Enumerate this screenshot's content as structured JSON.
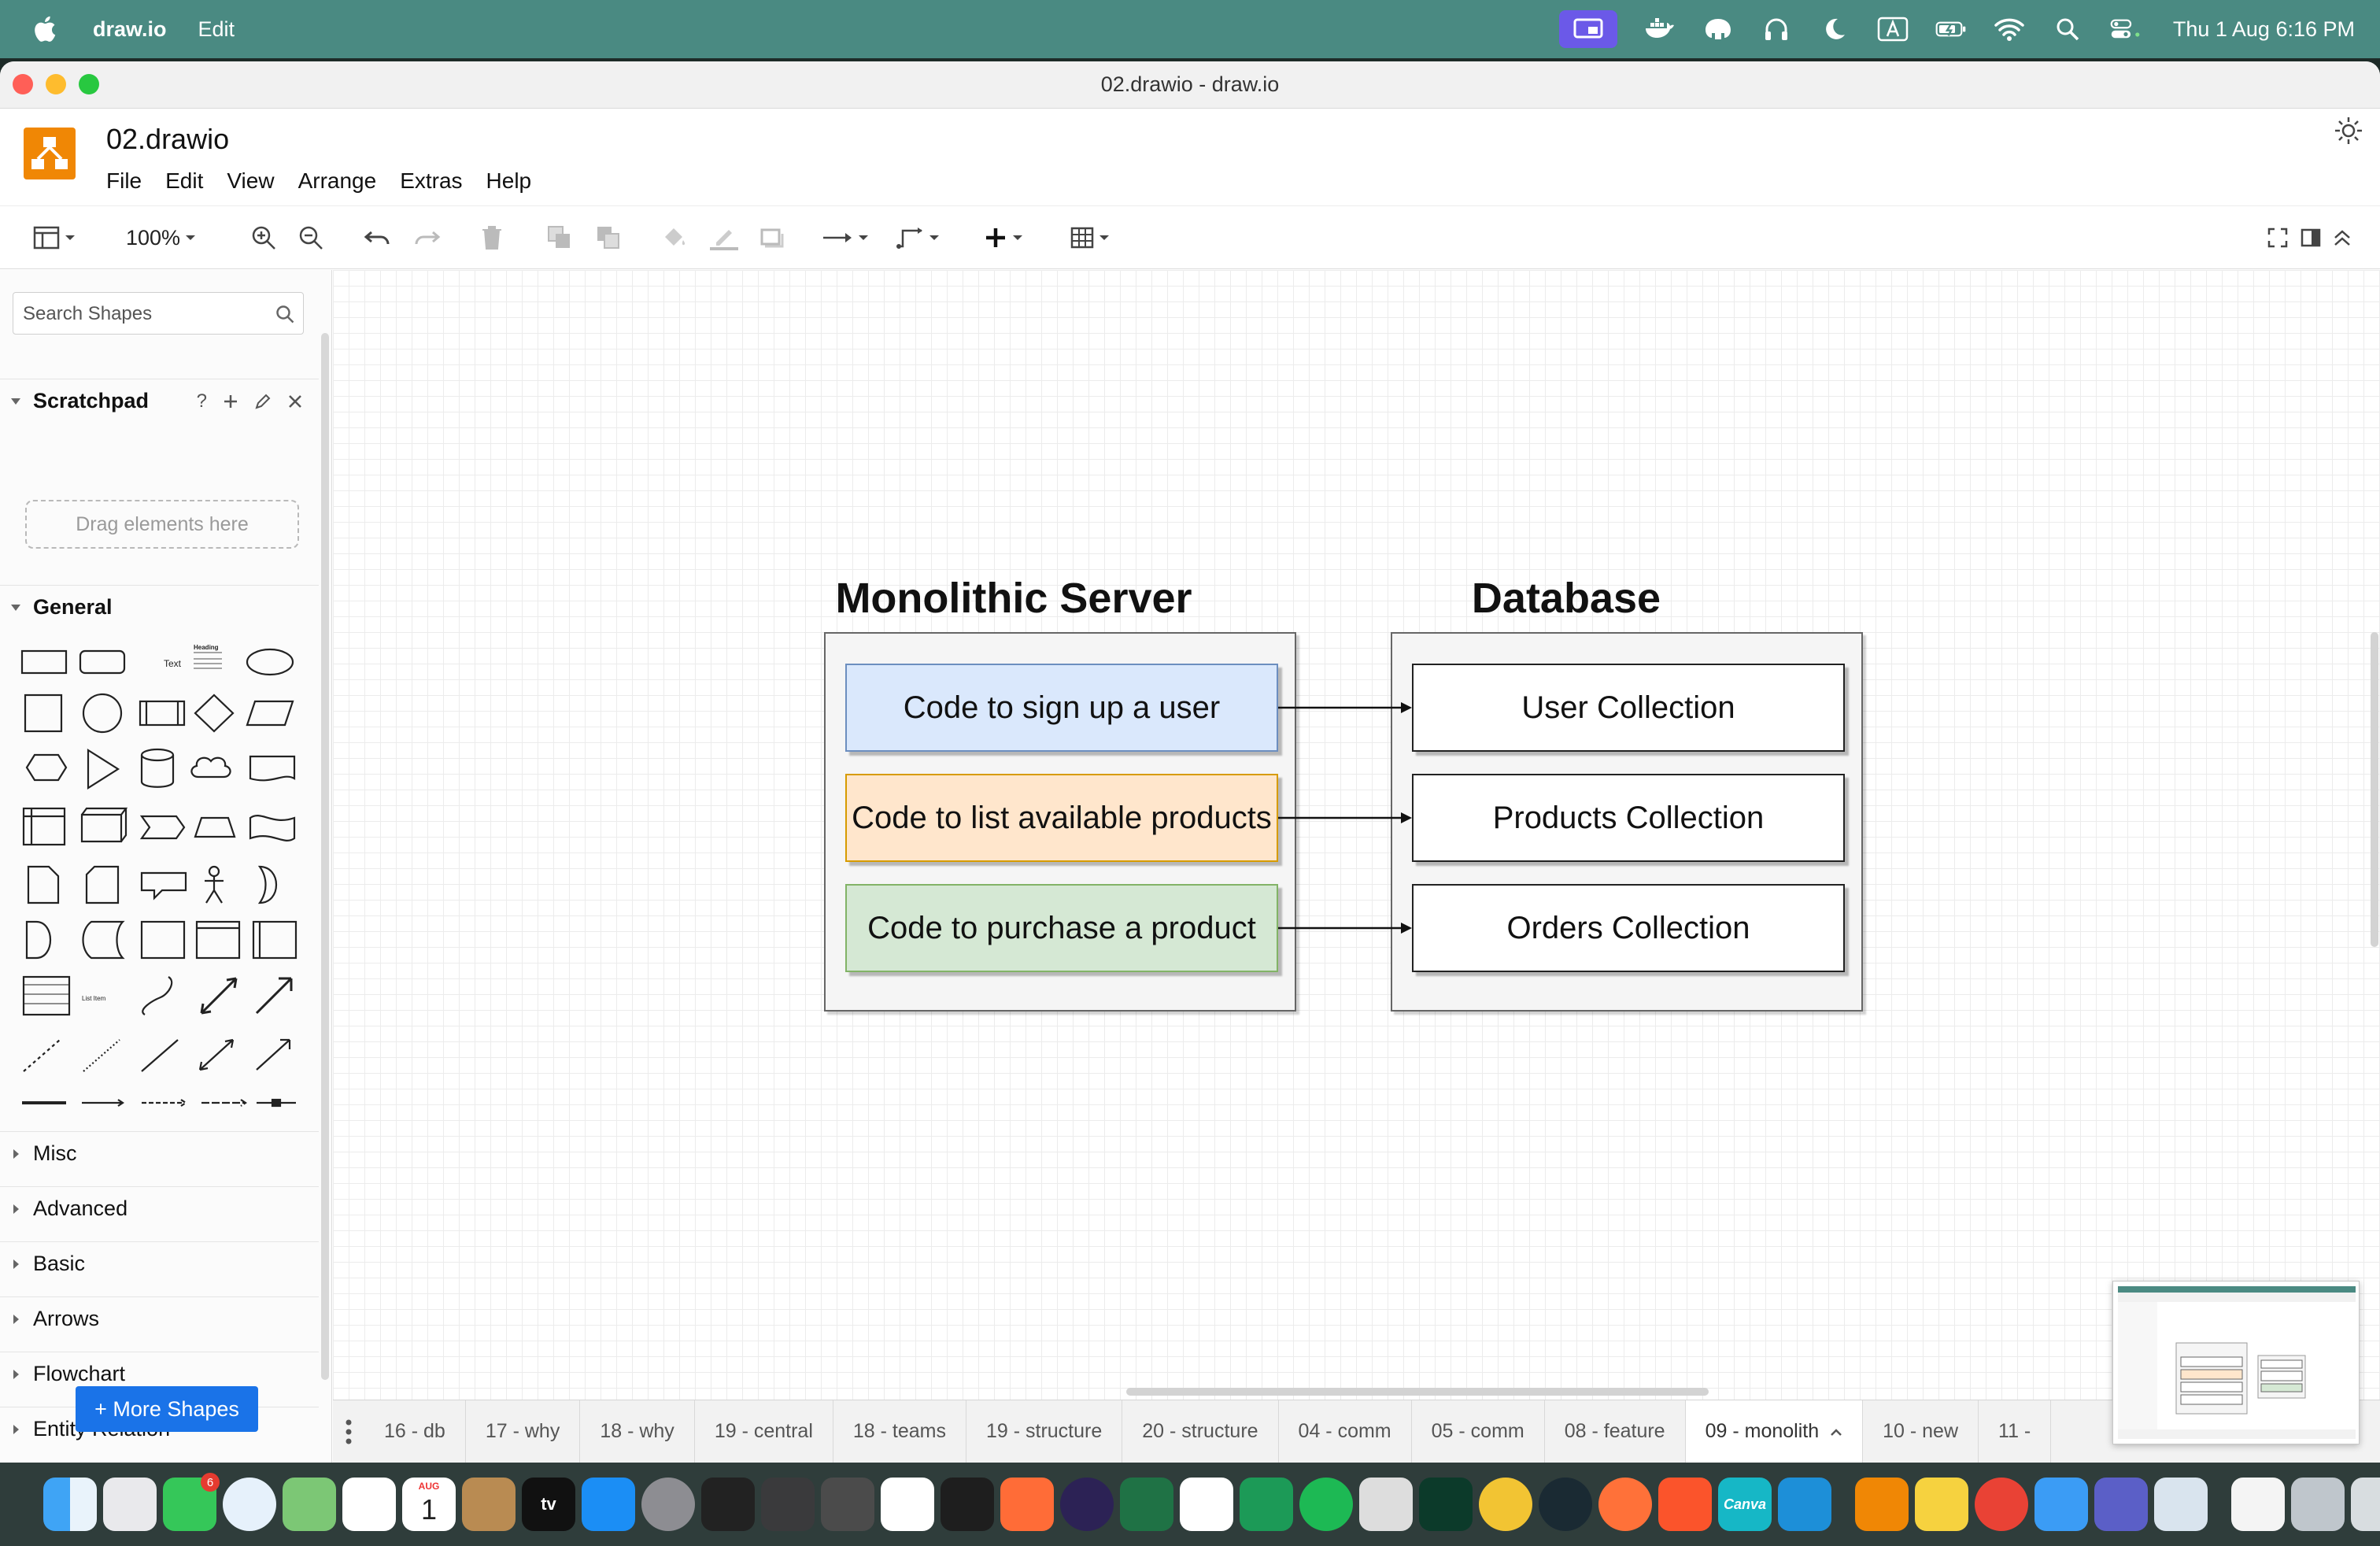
{
  "menubar": {
    "app_name": "draw.io",
    "menu_edit": "Edit",
    "clock": "Thu 1 Aug  6:16 PM",
    "status_icons": [
      "screen-mirroring-icon",
      "docker-icon",
      "tableplus-icon",
      "headphones-icon",
      "moon-icon",
      "input-source-icon",
      "battery-icon",
      "wifi-icon",
      "spotlight-icon",
      "control-center-icon"
    ]
  },
  "window": {
    "title": "02.drawio - draw.io"
  },
  "header": {
    "file_title": "02.drawio",
    "menus": [
      "File",
      "Edit",
      "View",
      "Arrange",
      "Extras",
      "Help"
    ]
  },
  "toolbar": {
    "zoom": "100%"
  },
  "sidebar": {
    "search_placeholder": "Search Shapes",
    "scratchpad": {
      "title": "Scratchpad",
      "help": "?",
      "drag_hint": "Drag elements here"
    },
    "general": {
      "title": "General",
      "text_shape_label": "Text",
      "heading_shape_label": "Heading",
      "list_item_label": "List Item"
    },
    "collapsed_sections": [
      "Misc",
      "Advanced",
      "Basic",
      "Arrows",
      "Flowchart",
      "Entity Relation"
    ],
    "more_shapes": "+ More Shapes"
  },
  "diagram": {
    "server_title": "Monolithic Server",
    "database_title": "Database",
    "server_blocks": [
      {
        "label": "Code to sign up a user",
        "fill": "#dae8fc",
        "stroke": "#6c8ebf"
      },
      {
        "label": "Code to list available products",
        "fill": "#ffe6cc",
        "stroke": "#d79b00"
      },
      {
        "label": "Code to purchase a product",
        "fill": "#d5e8d4",
        "stroke": "#82b366"
      }
    ],
    "collections": [
      {
        "label": "User Collection"
      },
      {
        "label": "Products Collection"
      },
      {
        "label": "Orders Collection"
      }
    ]
  },
  "page_tabs": [
    "16 - db",
    "17 - why",
    "18 - why",
    "19 - central",
    "18 - teams",
    "19 - structure",
    "20 - structure",
    "04 - comm",
    "05 - comm",
    "08 - feature",
    "09 - monolith",
    "10 - new",
    "11 - "
  ],
  "active_page_tab": "09 - monolith",
  "dock": {
    "calendar_month": "AUG",
    "calendar_day": "1",
    "messages_badge": "6",
    "canva_label": "Canva",
    "appletv_label": "tv"
  }
}
